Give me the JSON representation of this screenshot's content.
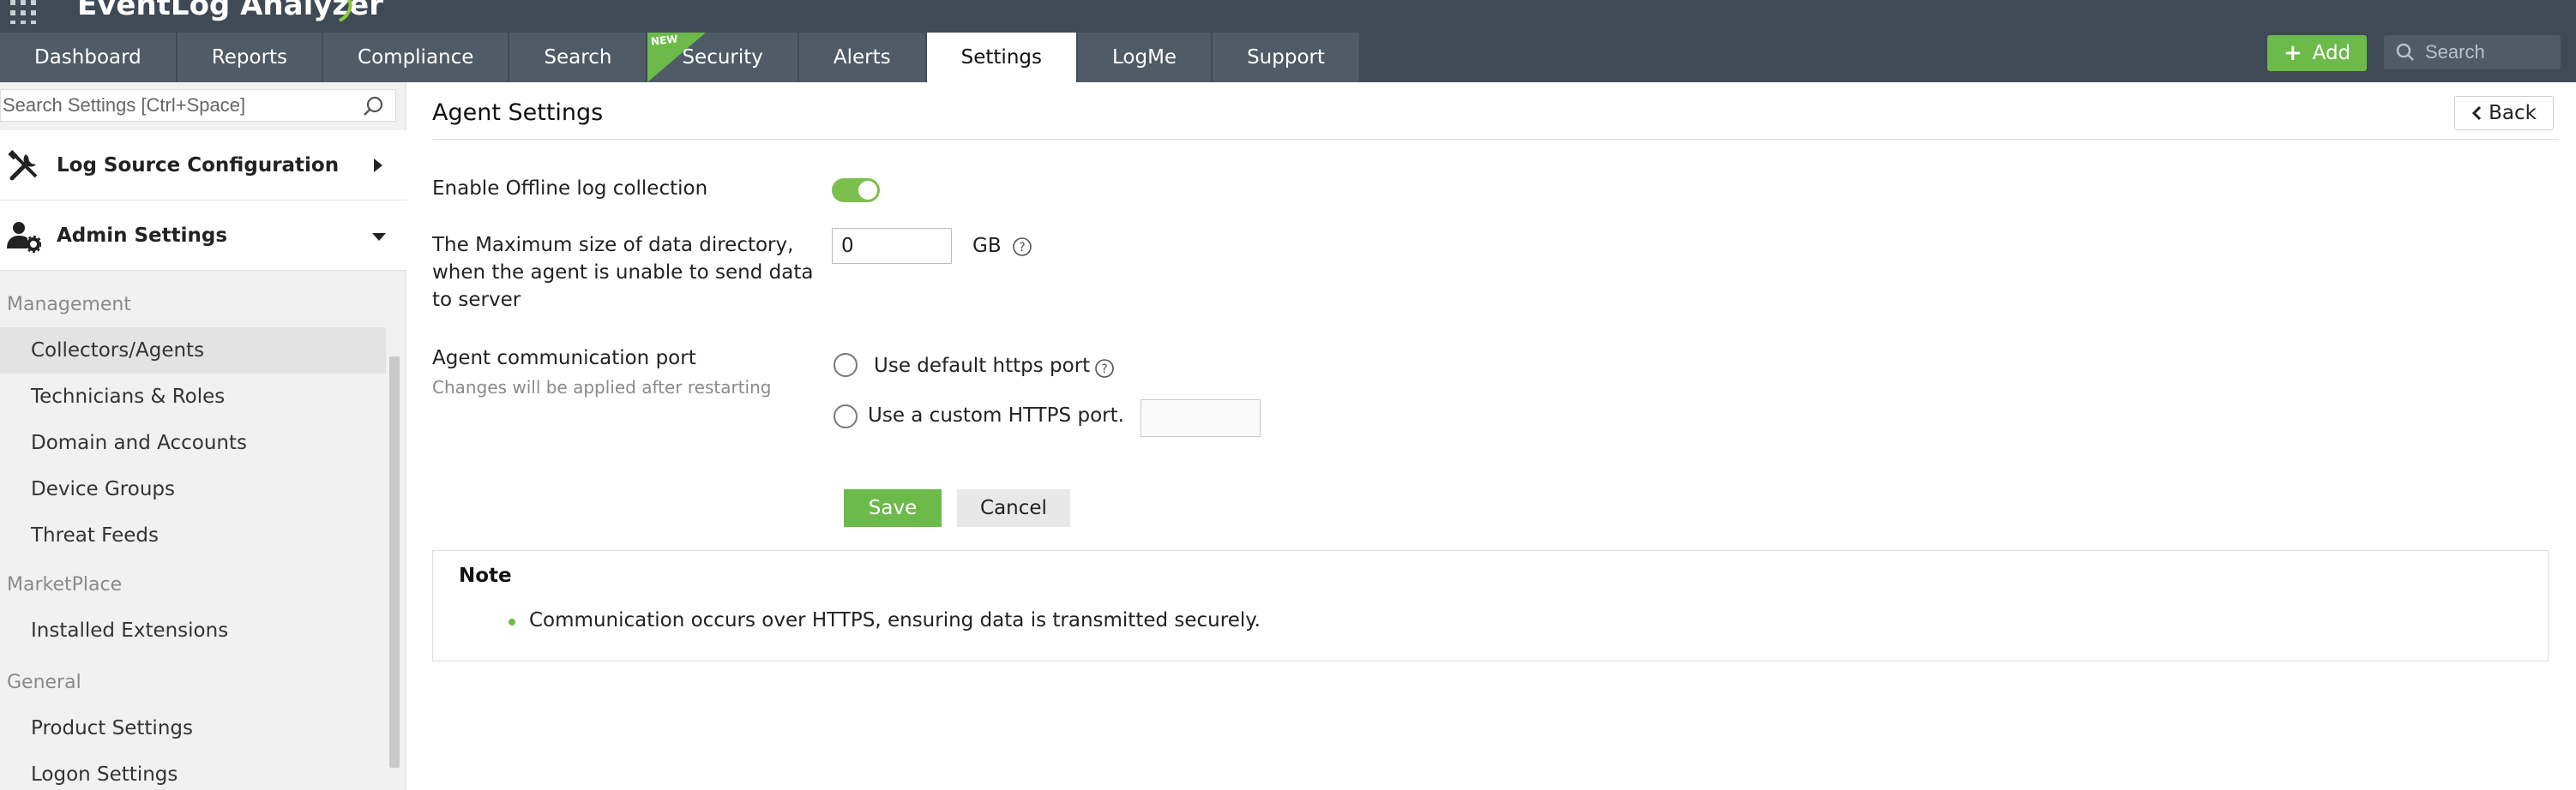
{
  "app": {
    "title": "EventLog Analyzer"
  },
  "nav": {
    "tabs": [
      {
        "label": "Dashboard"
      },
      {
        "label": "Reports"
      },
      {
        "label": "Compliance"
      },
      {
        "label": "Search"
      },
      {
        "label": "Security",
        "badge": "NEW"
      },
      {
        "label": "Alerts"
      },
      {
        "label": "Settings",
        "active": true
      },
      {
        "label": "LogMe"
      },
      {
        "label": "Support"
      }
    ],
    "add_label": "Add",
    "search_placeholder": "Search"
  },
  "sidebar": {
    "search_placeholder": "Search Settings [Ctrl+Space]",
    "sections": [
      {
        "label": "Log Source Configuration",
        "expanded": false
      },
      {
        "label": "Admin Settings",
        "expanded": true
      }
    ],
    "groups": [
      {
        "label": "Management",
        "items": [
          "Collectors/Agents",
          "Technicians & Roles",
          "Domain and Accounts",
          "Device Groups",
          "Threat Feeds"
        ]
      },
      {
        "label": "MarketPlace",
        "items": [
          "Installed Extensions"
        ]
      },
      {
        "label": "General",
        "items": [
          "Product Settings",
          "Logon Settings"
        ]
      }
    ],
    "selected_item": "Collectors/Agents"
  },
  "page": {
    "title": "Agent Settings",
    "back_label": "Back",
    "offline_label": "Enable Offline log collection",
    "offline_enabled": true,
    "max_size_label_lines": [
      "The Maximum size of data directory,",
      "when the agent is unable to send data",
      "to server"
    ],
    "max_size_value": "0",
    "max_size_unit": "GB",
    "port_label": "Agent communication port",
    "port_help": "Changes will be applied after restarting",
    "port_option_default": "Use default https port",
    "port_option_custom": "Use a custom HTTPS port.",
    "custom_port_value": "",
    "save_label": "Save",
    "cancel_label": "Cancel"
  },
  "note": {
    "title": "Note",
    "items": [
      "Communication occurs over HTTPS, ensuring data is transmitted securely."
    ]
  },
  "colors": {
    "header_bg": "#3e4a56",
    "tab_bg": "#4f5b67",
    "accent_green": "#6cba4a",
    "sidebar_bg": "#f1f1f1"
  },
  "icons": {
    "apps": "grid-icon",
    "search": "search-icon",
    "log_source": "tools-icon",
    "admin": "user-gear-icon",
    "help": "question-circle-icon",
    "back": "chevron-left-icon"
  }
}
